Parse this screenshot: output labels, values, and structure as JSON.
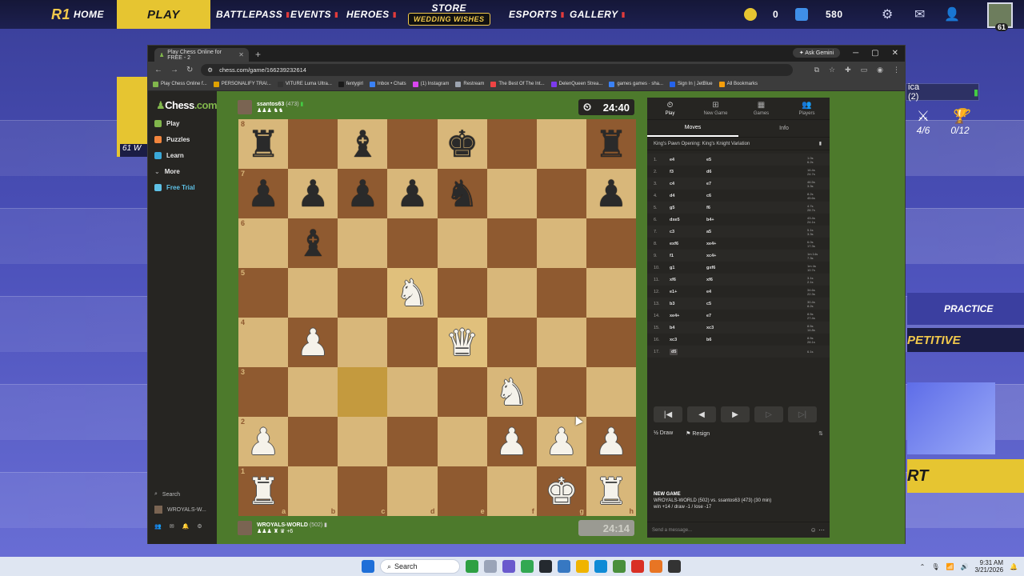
{
  "game_launcher": {
    "nav": {
      "home": "HOME",
      "play": "PLAY",
      "battlepass": "BATTLEPASS",
      "events": "EVENTS",
      "heroes": "HEROES",
      "store": "STORE",
      "store_promo": "WEDDING WISHES",
      "esports": "ESPORTS",
      "gallery": "GALLERY"
    },
    "currency": {
      "gold": "0",
      "gems": "580"
    },
    "player_level": "61",
    "left_card_label": "61 W",
    "right_panel": {
      "team_label": "ica (2)",
      "stat_1": "4/6",
      "stat_2": "0/12",
      "practice": "PRACTICE",
      "competitive": "PETITIVE",
      "start": "RT"
    },
    "colors": {
      "accent": "#e6c531",
      "bg": "#4a4fb8"
    }
  },
  "taskbar": {
    "search": "Search",
    "time": "9:31 AM",
    "date": "3/21/2026"
  },
  "browser": {
    "tab_title": "Play Chess Online for FREE - 2",
    "ask_gemini": "Ask Gemini",
    "url": "chess.com/game/166239232614",
    "bookmarks": [
      "Play Chess Online f...",
      "PERSONALIFY TRAI...",
      "VITURE Luma Ultra...",
      "fentygirl",
      "Inbox • Chats",
      "(1) Instagram",
      "Restream",
      "The Best Of The Int...",
      "DelenQueen Strea...",
      "games games · sha...",
      "Sign In | JetBlue",
      "All Bookmarks"
    ]
  },
  "chesscom": {
    "logo_prefix": "Chess",
    "logo_suffix": ".com",
    "nav": [
      "Play",
      "Puzzles",
      "Learn",
      "More",
      "Free Trial"
    ],
    "search": "Search",
    "user": "WROYALS-W...",
    "top_player": {
      "name": "ssantos63",
      "rating": "(473)",
      "clock": "24:40"
    },
    "bottom_player": {
      "name": "WROYALS-WORLD",
      "rating": "(502)",
      "extra": "+6",
      "clock": "24:14"
    },
    "panel": {
      "tabs": [
        "Play",
        "New Game",
        "Games",
        "Players"
      ],
      "subtabs": [
        "Moves",
        "Info"
      ],
      "opening": "King's Pawn Opening: King's Knight Variation",
      "moves": [
        {
          "n": "1.",
          "w": "e4",
          "b": "e5",
          "tw": "1.0s",
          "tb": "6.2s"
        },
        {
          "n": "2.",
          "w": "f3",
          "b": "d6",
          "tw": "16.4s",
          "tb": "24.7s"
        },
        {
          "n": "3.",
          "w": "c4",
          "b": "e7",
          "tw": "46.5s",
          "tb": "3.3s"
        },
        {
          "n": "4.",
          "w": "d4",
          "b": "c6",
          "tw": "8.2s",
          "tb": "45.6s"
        },
        {
          "n": "5.",
          "w": "g5",
          "b": "f6",
          "tw": "4.7s",
          "tb": "28.7s"
        },
        {
          "n": "6.",
          "w": "dxe5",
          "b": "b4+",
          "tw": "43.4s",
          "tb": "24.1s"
        },
        {
          "n": "7.",
          "w": "c3",
          "b": "a5",
          "tw": "5.1s",
          "tb": "3.3s"
        },
        {
          "n": "8.",
          "w": "exf6",
          "b": "xe4+",
          "tw": "6.0s",
          "tb": "17.3s"
        },
        {
          "n": "9.",
          "w": "f1",
          "b": "xc4+",
          "tw": "1m 14s",
          "tb": "7.3s"
        },
        {
          "n": "10.",
          "w": "g1",
          "b": "gxf6",
          "tw": "1m 4s",
          "tb": "10.7s"
        },
        {
          "n": "11.",
          "w": "xf6",
          "b": "xf6",
          "tw": "3.1s",
          "tb": "2.1s"
        },
        {
          "n": "12.",
          "w": "e1+",
          "b": "e4",
          "tw": "34.6s",
          "tb": "22.3s"
        },
        {
          "n": "13.",
          "w": "b3",
          "b": "c5",
          "tw": "30.4s",
          "tb": "8.2s"
        },
        {
          "n": "14.",
          "w": "xe4+",
          "b": "e7",
          "tw": "8.5s",
          "tb": "27.4s"
        },
        {
          "n": "15.",
          "w": "b4",
          "b": "xc3",
          "tw": "8.5s",
          "tb": "14.8s"
        },
        {
          "n": "16.",
          "w": "xc3",
          "b": "b6",
          "tw": "8.5s",
          "tb": "28.1s"
        },
        {
          "n": "17.",
          "w": "d5",
          "b": "",
          "tw": "6.1s",
          "tb": ""
        }
      ],
      "draw": "Draw",
      "resign": "Resign",
      "new_game_heading": "NEW GAME",
      "new_game_line": "WROYALS-WORLD (502) vs. ssantos63 (473) (30 min)",
      "new_game_record": "win +14 / draw -1 / lose -17",
      "message_placeholder": "Send a message..."
    },
    "board": {
      "ranks": [
        "8",
        "7",
        "6",
        "5",
        "4",
        "3",
        "2",
        "1"
      ],
      "files": [
        "a",
        "b",
        "c",
        "d",
        "e",
        "f",
        "g",
        "h"
      ],
      "position": [
        [
          "br",
          "",
          "bb",
          "",
          "bk",
          "",
          "",
          "br"
        ],
        [
          "bp",
          "bp",
          "bp",
          "bp",
          "bn",
          "",
          "",
          "bp"
        ],
        [
          "",
          "bb",
          "",
          "",
          "",
          "",
          "",
          ""
        ],
        [
          "",
          "",
          "",
          "wn",
          "",
          "",
          "",
          ""
        ],
        [
          "",
          "wp",
          "",
          "",
          "wq",
          "",
          "",
          ""
        ],
        [
          "",
          "",
          "",
          "",
          "",
          "wn",
          "",
          ""
        ],
        [
          "wp",
          "",
          "",
          "",
          "",
          "wp",
          "wp",
          "wp"
        ],
        [
          "wr",
          "",
          "",
          "",
          "",
          "",
          "wk",
          "wr"
        ]
      ],
      "highlights": [
        "d5",
        "e4",
        "c3"
      ]
    }
  }
}
